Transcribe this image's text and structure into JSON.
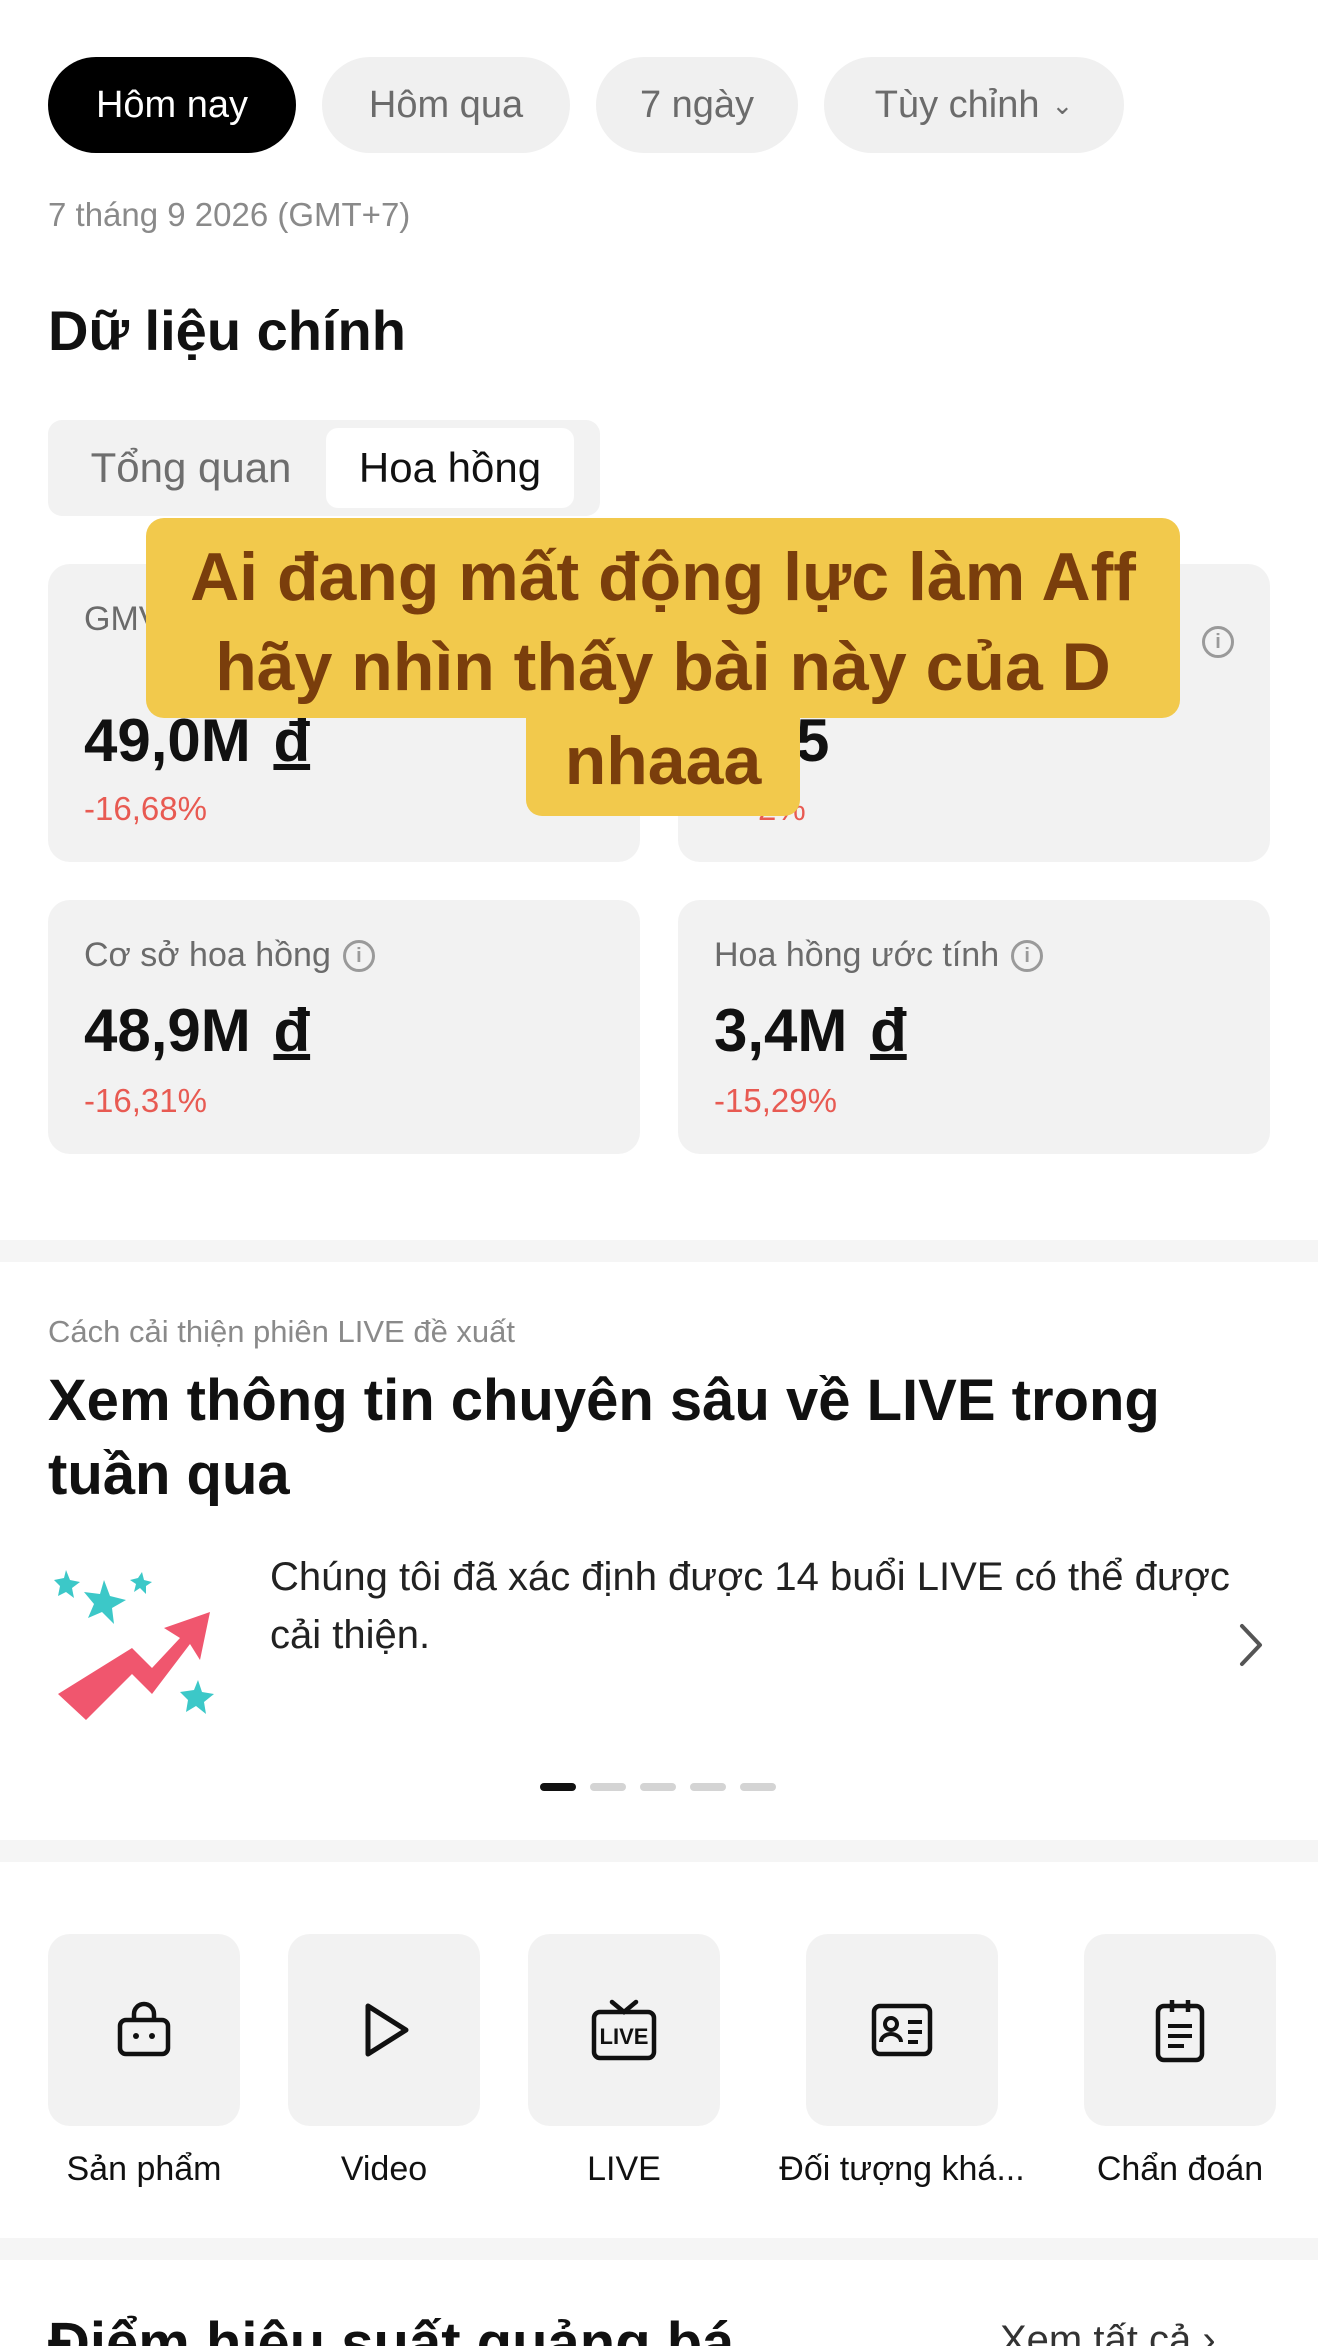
{
  "filters": {
    "today": "Hôm nay",
    "yesterday": "Hôm qua",
    "seven_days": "7 ngày",
    "custom": "Tùy chỉnh"
  },
  "date_text": "7 tháng 9 2026 (GMT+7)",
  "main_title": "Dữ liệu chính",
  "tabs": {
    "overview": "Tổng quan",
    "commission": "Hoa hồng"
  },
  "cards": [
    {
      "label": "GMV",
      "value": "49,0M",
      "currency": "đ",
      "change": "-16,68%"
    },
    {
      "label": "",
      "value": "5",
      "currency": "",
      "change": "2%"
    },
    {
      "label": "Cơ sở hoa hồng",
      "value": "48,9M",
      "currency": "đ",
      "change": "-16,31%"
    },
    {
      "label": "Hoa hồng ước tính",
      "value": "3,4M",
      "currency": "đ",
      "change": "-15,29%"
    }
  ],
  "overlay": {
    "line1": "Ai đang mất động lực làm Aff",
    "line2": "hãy nhìn thấy bài này của D",
    "line3": "nhaaa"
  },
  "insight": {
    "eyebrow": "Cách cải thiện phiên LIVE đề xuất",
    "title": "Xem thông tin chuyên sâu về LIVE trong tuần qua",
    "text": "Chúng tôi đã xác định được 14 buổi LIVE có thể được cải thiện.",
    "page_count": 5,
    "active_page": 1
  },
  "shortcuts": [
    {
      "label": "Sản phẩm",
      "icon": "shopping-bag-icon"
    },
    {
      "label": "Video",
      "icon": "play-icon"
    },
    {
      "label": "LIVE",
      "icon": "live-tv-icon"
    },
    {
      "label": "Đối tượng khá...",
      "icon": "id-card-icon"
    },
    {
      "label": "Chẩn đoán",
      "icon": "clipboard-icon"
    }
  ],
  "bottom": {
    "title": "Điểm hiệu suất quảng bá",
    "link": "Xem tất cả"
  },
  "colors": {
    "negative": "#e85a52",
    "overlay_bg": "#f2c94c",
    "overlay_text": "#7a3e0c",
    "live_art_pink": "#f0566e",
    "live_art_teal": "#3cc8c8"
  }
}
